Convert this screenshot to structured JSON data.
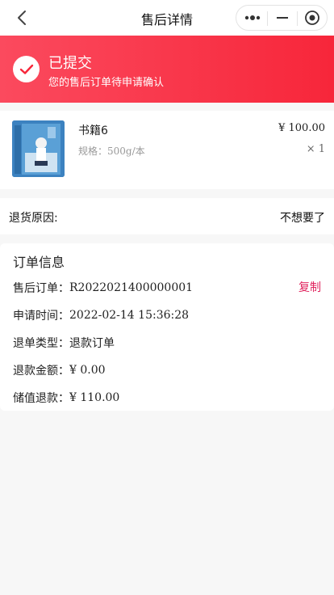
{
  "nav": {
    "title": "售后详情"
  },
  "status": {
    "title": "已提交",
    "subtitle": "您的售后订单待申请确认"
  },
  "product": {
    "name": "书籍6",
    "spec": "规格：500g/本",
    "price": "¥ 100.00",
    "quantity": "× 1"
  },
  "reason": {
    "label": "退货原因:",
    "value": "不想要了"
  },
  "order_info": {
    "title": "订单信息",
    "copy_label": "复制",
    "rows": [
      {
        "key": "售后订单：",
        "value": "R2022021400000001"
      },
      {
        "key": "申请时间：",
        "value": "2022-02-14 15:36:28"
      },
      {
        "key": "退单类型：",
        "value": "退款订单"
      },
      {
        "key": "退款金额：",
        "value": "¥ 0.00"
      },
      {
        "key": "储值退款：",
        "value": "¥ 110.00"
      }
    ]
  },
  "colors": {
    "accent": "#f7263a",
    "copy": "#e0245e"
  }
}
